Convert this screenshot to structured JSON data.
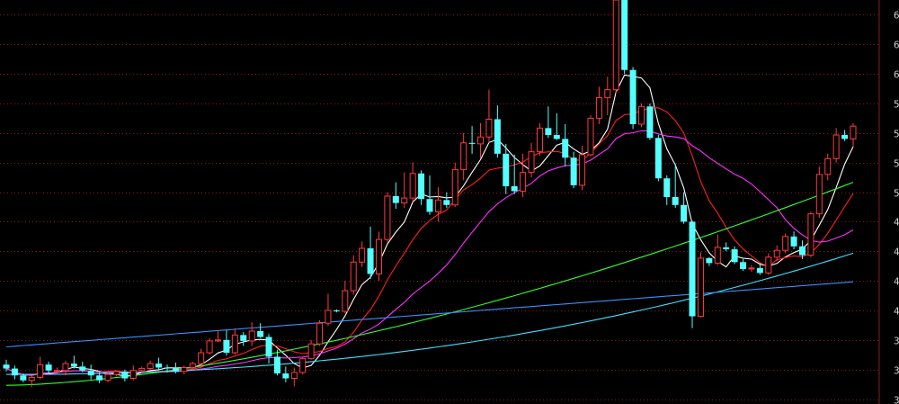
{
  "chart_data": {
    "type": "candlestick",
    "ylim": [
      28.5,
      69.5
    ],
    "yticks": [
      {
        "value": 68,
        "label": "6"
      },
      {
        "value": 65,
        "label": "6"
      },
      {
        "value": 62,
        "label": "6"
      },
      {
        "value": 59,
        "label": "5"
      },
      {
        "value": 56,
        "label": "5"
      },
      {
        "value": 53,
        "label": "5"
      },
      {
        "value": 50,
        "label": "5"
      },
      {
        "value": 47,
        "label": "4"
      },
      {
        "value": 44,
        "label": "4"
      },
      {
        "value": 41,
        "label": "4"
      },
      {
        "value": 38,
        "label": "4"
      },
      {
        "value": 35,
        "label": "3"
      },
      {
        "value": 32,
        "label": "3"
      },
      {
        "value": 29,
        "label": "3"
      }
    ],
    "grid": true,
    "colors": {
      "background": "#000000",
      "up": "#ff3b3b",
      "down": "#54ffff",
      "grid": "#8b1a1a",
      "ma5": "#ffffff",
      "ma10": "#ff2020",
      "ma20": "#ff30ff",
      "ma60": "#30ff30",
      "ma120": "#40e0ff",
      "ma250": "#3a8fff"
    },
    "candles": [
      [
        32.5,
        33.0,
        31.8,
        32.1
      ],
      [
        32.1,
        32.4,
        31.0,
        31.4
      ],
      [
        31.4,
        31.6,
        30.7,
        30.9
      ],
      [
        30.9,
        31.4,
        30.2,
        31.2
      ],
      [
        31.2,
        33.3,
        31.0,
        32.5
      ],
      [
        32.5,
        32.8,
        31.6,
        31.9
      ],
      [
        31.9,
        32.2,
        31.7,
        31.9
      ],
      [
        31.9,
        32.9,
        31.4,
        32.6
      ],
      [
        32.6,
        33.4,
        32.1,
        32.3
      ],
      [
        32.3,
        32.8,
        31.7,
        31.9
      ],
      [
        31.9,
        32.5,
        31.0,
        31.4
      ],
      [
        31.4,
        31.7,
        30.6,
        30.9
      ],
      [
        30.9,
        31.7,
        30.7,
        31.5
      ],
      [
        31.5,
        31.9,
        31.3,
        31.8
      ],
      [
        31.8,
        32.0,
        30.8,
        31.1
      ],
      [
        31.1,
        32.4,
        30.9,
        31.9
      ],
      [
        31.9,
        32.3,
        31.6,
        32.1
      ],
      [
        32.1,
        32.9,
        31.9,
        32.6
      ],
      [
        32.6,
        33.2,
        32.0,
        32.2
      ],
      [
        32.2,
        32.5,
        31.7,
        32.1
      ],
      [
        32.1,
        32.7,
        31.6,
        31.8
      ],
      [
        31.8,
        32.4,
        31.5,
        32.2
      ],
      [
        32.2,
        32.8,
        32.0,
        32.6
      ],
      [
        32.6,
        34.1,
        32.2,
        33.7
      ],
      [
        33.7,
        35.2,
        33.5,
        34.9
      ],
      [
        34.9,
        36.0,
        34.8,
        35.0
      ],
      [
        35.0,
        36.0,
        33.4,
        33.7
      ],
      [
        33.7,
        36.2,
        33.5,
        35.5
      ],
      [
        35.5,
        35.8,
        34.4,
        34.9
      ],
      [
        34.9,
        36.8,
        34.4,
        35.9
      ],
      [
        35.9,
        36.7,
        35.2,
        35.3
      ],
      [
        35.3,
        35.6,
        32.6,
        33.3
      ],
      [
        33.3,
        34.0,
        31.4,
        31.6
      ],
      [
        31.6,
        32.3,
        30.7,
        31.1
      ],
      [
        31.1,
        32.2,
        30.3,
        31.7
      ],
      [
        31.7,
        33.3,
        31.5,
        33.1
      ],
      [
        33.1,
        35.0,
        33.0,
        34.6
      ],
      [
        34.6,
        37.0,
        34.4,
        36.7
      ],
      [
        36.7,
        39.7,
        36.4,
        38.0
      ],
      [
        38.0,
        38.1,
        37.8,
        37.9
      ],
      [
        37.9,
        41.0,
        37.7,
        40.0
      ],
      [
        40.0,
        43.6,
        39.6,
        42.9
      ],
      [
        42.9,
        45.0,
        42.4,
        44.3
      ],
      [
        44.3,
        46.5,
        41.2,
        41.7
      ],
      [
        41.7,
        46.0,
        41.0,
        45.2
      ],
      [
        45.2,
        50.0,
        44.9,
        49.6
      ],
      [
        49.6,
        51.0,
        48.3,
        48.9
      ],
      [
        48.9,
        52.0,
        48.4,
        49.4
      ],
      [
        49.4,
        53.0,
        49.0,
        51.9
      ],
      [
        51.9,
        52.2,
        48.7,
        49.3
      ],
      [
        49.3,
        51.7,
        47.7,
        48.0
      ],
      [
        48.0,
        50.5,
        47.0,
        49.2
      ],
      [
        49.2,
        50.0,
        48.4,
        48.7
      ],
      [
        48.7,
        53.0,
        48.5,
        52.3
      ],
      [
        52.3,
        56.0,
        51.2,
        55.0
      ],
      [
        55.0,
        56.7,
        53.9,
        54.9
      ],
      [
        54.9,
        57.0,
        53.4,
        55.6
      ],
      [
        55.6,
        60.4,
        55.0,
        57.4
      ],
      [
        57.4,
        58.8,
        53.5,
        53.9
      ],
      [
        53.9,
        54.9,
        49.8,
        50.6
      ],
      [
        50.6,
        53.8,
        49.8,
        50.1
      ],
      [
        50.1,
        53.9,
        49.5,
        52.0
      ],
      [
        52.0,
        55.0,
        51.5,
        54.1
      ],
      [
        54.1,
        57.0,
        53.7,
        56.5
      ],
      [
        56.5,
        58.7,
        55.5,
        55.8
      ],
      [
        55.8,
        58.0,
        55.3,
        55.4
      ],
      [
        55.4,
        56.9,
        52.6,
        53.5
      ],
      [
        53.5,
        54.1,
        50.4,
        50.7
      ],
      [
        50.7,
        54.7,
        50.2,
        53.8
      ],
      [
        53.8,
        57.8,
        53.6,
        57.5
      ],
      [
        57.5,
        60.7,
        56.9,
        59.6
      ],
      [
        59.6,
        61.7,
        57.8,
        60.4
      ],
      [
        60.4,
        70.0,
        60.0,
        69.5
      ],
      [
        69.5,
        69.6,
        62.0,
        62.4
      ],
      [
        62.4,
        62.7,
        56.4,
        56.9
      ],
      [
        56.9,
        59.0,
        56.6,
        58.7
      ],
      [
        58.7,
        59.0,
        55.3,
        55.5
      ],
      [
        55.5,
        55.8,
        51.1,
        51.4
      ],
      [
        51.4,
        51.7,
        48.7,
        49.5
      ],
      [
        49.5,
        52.9,
        48.4,
        48.7
      ],
      [
        48.7,
        50.0,
        46.8,
        47.0
      ],
      [
        47.0,
        47.1,
        36.2,
        37.4
      ],
      [
        37.4,
        43.9,
        37.3,
        43.3
      ],
      [
        43.3,
        43.4,
        42.5,
        42.8
      ],
      [
        42.8,
        45.7,
        42.6,
        44.4
      ],
      [
        44.4,
        44.9,
        44.0,
        44.2
      ],
      [
        44.2,
        44.5,
        42.7,
        42.9
      ],
      [
        42.9,
        43.2,
        42.0,
        42.2
      ],
      [
        42.2,
        42.6,
        41.9,
        42.3
      ],
      [
        42.3,
        42.8,
        41.6,
        41.8
      ],
      [
        41.8,
        43.8,
        41.6,
        43.4
      ],
      [
        43.4,
        44.6,
        43.0,
        44.1
      ],
      [
        44.1,
        45.8,
        43.8,
        45.5
      ],
      [
        45.5,
        46.0,
        44.2,
        44.5
      ],
      [
        44.5,
        45.1,
        43.2,
        43.6
      ],
      [
        43.6,
        48.0,
        43.4,
        47.8
      ],
      [
        47.8,
        52.6,
        47.4,
        51.8
      ],
      [
        51.8,
        53.9,
        51.2,
        53.4
      ],
      [
        53.4,
        56.5,
        53.0,
        55.8
      ],
      [
        55.8,
        56.3,
        55.2,
        55.4
      ],
      [
        55.4,
        57.0,
        54.6,
        56.7
      ]
    ],
    "moving_averages": [
      {
        "key": "ma5",
        "period": 5
      },
      {
        "key": "ma10",
        "period": 10
      },
      {
        "key": "ma20",
        "period": 20
      },
      {
        "key": "ma60",
        "start": 30.4,
        "end": 51.0,
        "curve": 1.6
      },
      {
        "key": "ma120",
        "start": 31.5,
        "end": 43.8,
        "curve": 2.2
      },
      {
        "key": "ma250",
        "start": 34.3,
        "end": 40.9,
        "curve": 1.0
      }
    ]
  }
}
